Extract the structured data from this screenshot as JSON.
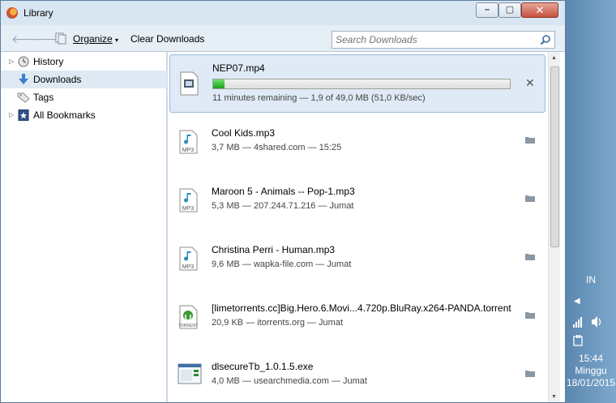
{
  "window": {
    "title": "Library",
    "close_glyph": "✕",
    "minimize_glyph": "–",
    "maximize_glyph": "▢"
  },
  "toolbar": {
    "back_glyph": "🡐",
    "forward_glyph": "🡒",
    "organize_label": "Organize",
    "clear_downloads_label": "Clear Downloads",
    "search_placeholder": "Search Downloads"
  },
  "sidebar": {
    "items": [
      {
        "label": "History",
        "icon": "clock-icon",
        "expandable": true,
        "selected": false
      },
      {
        "label": "Downloads",
        "icon": "download-arrow-icon",
        "expandable": false,
        "selected": true
      },
      {
        "label": "Tags",
        "icon": "tag-icon",
        "expandable": false,
        "selected": false
      },
      {
        "label": "All Bookmarks",
        "icon": "bookmarks-star-icon",
        "expandable": true,
        "selected": false
      }
    ]
  },
  "downloads": [
    {
      "name": "NEP07.mp4",
      "status": "11 minutes remaining — 1,9 of 49,0 MB (51,0 KB/sec)",
      "icon": "video-file-icon",
      "progress": 0.039,
      "in_progress": true
    },
    {
      "name": "Cool Kids.mp3",
      "status": "3,7 MB — 4shared.com — 15:25",
      "icon": "mp3-file-icon"
    },
    {
      "name": "Maroon 5 - Animals -- Pop-1.mp3",
      "status": "5,3 MB — 207.244.71.216 — Jumat",
      "icon": "mp3-file-icon"
    },
    {
      "name": "Christina Perri - Human.mp3",
      "status": "9,6 MB — wapka-file.com — Jumat",
      "icon": "mp3-file-icon"
    },
    {
      "name": "[limetorrents.cc]Big.Hero.6.Movi...4.720p.BluRay.x264-PANDA.torrent",
      "status": "20,9 KB — itorrents.org — Jumat",
      "icon": "torrent-file-icon"
    },
    {
      "name": "dlsecureTb_1.0.1.5.exe",
      "status": "4,0 MB — usearchmedia.com — Jumat",
      "icon": "exe-file-icon"
    }
  ],
  "taskbar": {
    "language": "IN",
    "time": "15:44",
    "day": "Minggu",
    "date": "18/01/2015"
  },
  "colors": {
    "selected_row": "#dfe9f4",
    "active_download_bg": "#dfeaf6",
    "progress_green": "#2bbf2b",
    "close_button": "#c7503d"
  }
}
